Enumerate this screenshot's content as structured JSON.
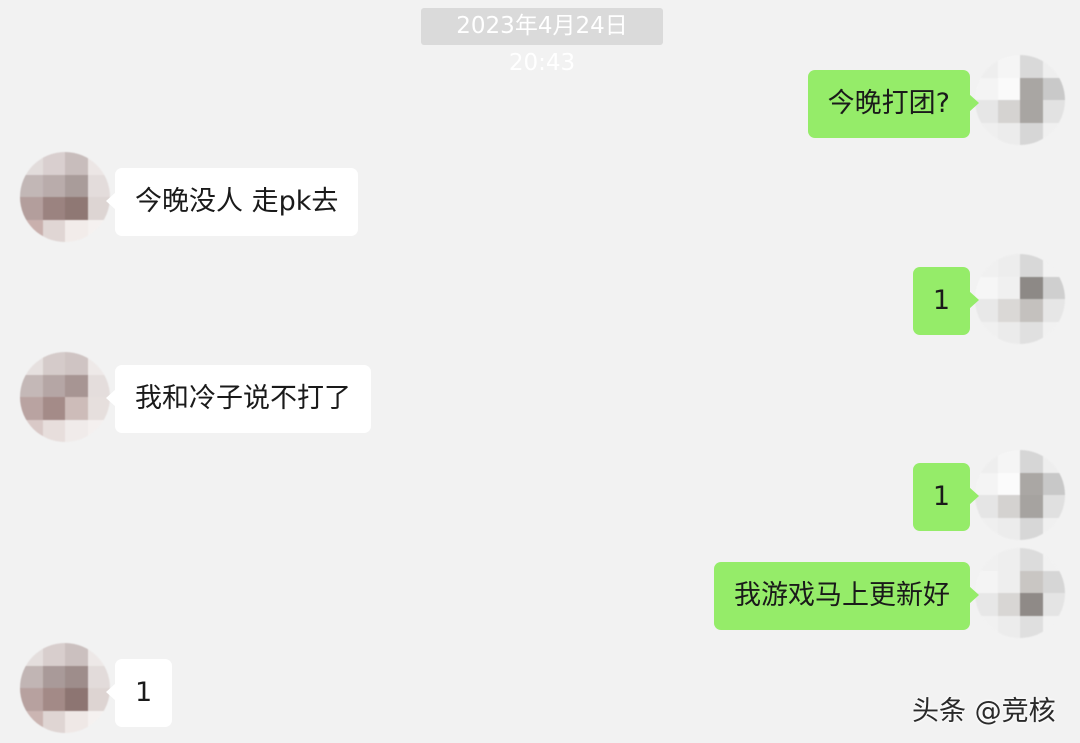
{
  "timestamp": "2023年4月24日 20:43",
  "messages": [
    {
      "from": "me",
      "text": "今晚打团?"
    },
    {
      "from": "friend",
      "text": "今晚没人 走pk去"
    },
    {
      "from": "me",
      "text": "1"
    },
    {
      "from": "friend",
      "text": "我和冷子说不打了"
    },
    {
      "from": "me",
      "text": "1"
    },
    {
      "from": "me",
      "text": "我游戏马上更新好"
    },
    {
      "from": "friend",
      "text": "1"
    }
  ],
  "watermark": "头条 @竞核",
  "colors": {
    "background": "#f2f2f2",
    "outgoing_bubble": "#95ec69",
    "incoming_bubble": "#ffffff",
    "timestamp_pill": "#dadada"
  }
}
